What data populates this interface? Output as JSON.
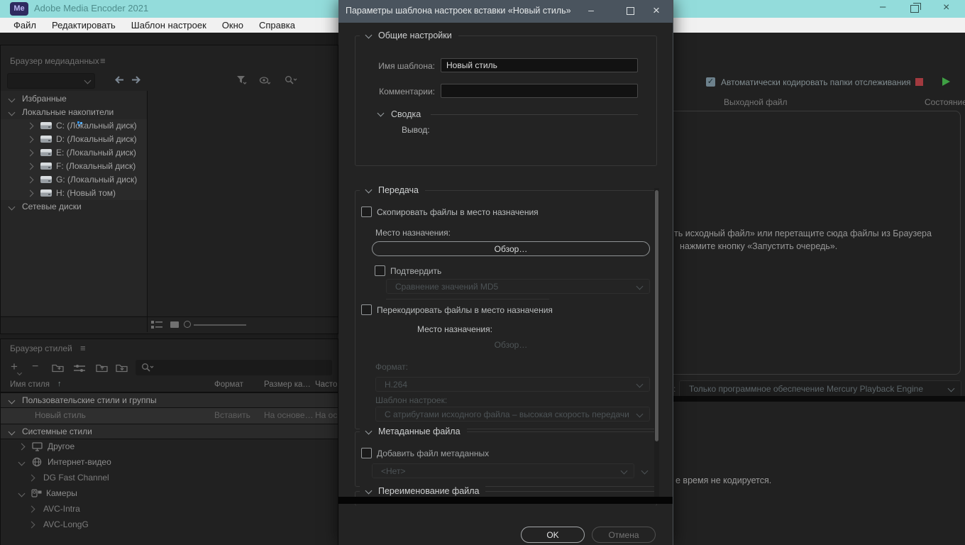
{
  "window": {
    "logo": "Me",
    "title": "Adobe Media Encoder 2021",
    "menu": [
      "Файл",
      "Редактировать",
      "Шаблон настроек",
      "Окно",
      "Справка"
    ]
  },
  "media_browser": {
    "title": "Браузер медиаданных",
    "tree": [
      {
        "label": "Избранные"
      },
      {
        "label": "Локальные накопители"
      },
      {
        "label": "C: (Локальный диск)"
      },
      {
        "label": "D: (Локальный диск)"
      },
      {
        "label": "E: (Локальный диск)"
      },
      {
        "label": "F: (Локальный диск)"
      },
      {
        "label": "G: (Локальный диск)"
      },
      {
        "label": "H: (Новый том)"
      },
      {
        "label": "Сетевые диски"
      }
    ]
  },
  "preset_browser": {
    "title": "Браузер стилей",
    "columns": [
      "Имя стиля",
      "Формат",
      "Размер ка…",
      "Часто…"
    ],
    "rows": [
      {
        "label": "Пользовательские стили и группы"
      },
      {
        "label": "Новый стиль",
        "format": "Вставить",
        "frame_size": "На основе…",
        "frame_rate": "На ос…"
      },
      {
        "label": "Системные стили"
      },
      {
        "label": "Другое"
      },
      {
        "label": "Интернет-видео"
      },
      {
        "label": "DG Fast Channel"
      },
      {
        "label": "Камеры"
      },
      {
        "label": "AVC-Intra"
      },
      {
        "label": "AVC-LongG"
      }
    ]
  },
  "queue": {
    "auto_encode": "Автоматически кодировать папки отслеживания",
    "col_output": "Выходной файл",
    "col_status": "Состояние",
    "hint_line1": "ть исходный файл» или перетащите сюда файлы из Браузера",
    "hint_line2": "нажмите кнопку «Запустить очередь».",
    "renderer_label_fragment": ":",
    "renderer": "Только программное обеспечение Mercury Playback Engine",
    "status": "е время не кодируется."
  },
  "dialog": {
    "title": "Параметры шаблона настроек вставки «Новый стиль»",
    "general": {
      "section": "Общие настройки",
      "name_label": "Имя шаблона:",
      "name_value": "Новый стиль",
      "comments_label": "Комментарии:",
      "comments_value": "",
      "summary_label": "Сводка",
      "output_label": "Вывод:"
    },
    "transfer": {
      "section": "Передача",
      "copy_label": "Скопировать файлы в место назначения",
      "destination_label": "Место назначения:",
      "browse_label": "Обзор…",
      "verify_label": "Подтвердить",
      "verify_value": "Сравнение значений MD5",
      "transcode_label": "Перекодировать файлы в место назначения",
      "destination2_label": "Место назначения:",
      "browse2_label": "Обзор…",
      "format_label": "Формат:",
      "format_value": "H.264",
      "preset_label": "Шаблон настроек:",
      "preset_value": "С атрибутами исходного файла – высокая скорость передачи"
    },
    "metadata": {
      "section": "Метаданные файла",
      "add_label": "Добавить файл метаданных",
      "value": "<Нет>"
    },
    "rename": {
      "section": "Переименование файла"
    },
    "ok": "OK",
    "cancel": "Отмена"
  },
  "icons": {
    "hamburger": "≡",
    "sort_up_arrow": "↑",
    "check": "✓",
    "minimize": "–",
    "close": "×"
  },
  "colors": {
    "main_titlebar": "#93dcdb",
    "dialog_titlebar": "#4a545e",
    "stop": "#a23a3f",
    "play": "#3fa044",
    "drive_led": "#2f8fe8"
  }
}
